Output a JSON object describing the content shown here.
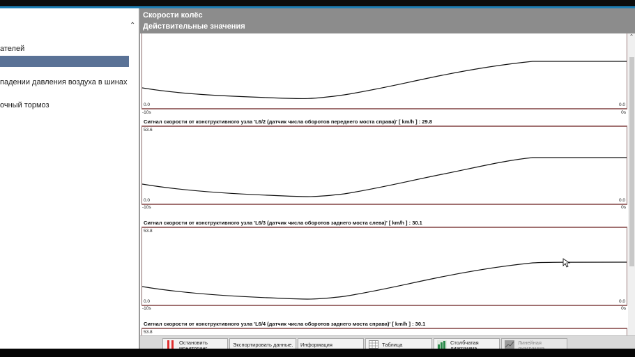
{
  "left_panel": {
    "items": [
      {
        "label": "ателей"
      },
      {
        "label": ""
      },
      {
        "label": "падении давления воздуха в шинах"
      },
      {
        "label": "очный тормоз"
      }
    ]
  },
  "header": {
    "title": "Скорости колёс",
    "subtitle": "Действительные значения"
  },
  "panels": [
    {
      "title": "",
      "y_max": "",
      "y_min_left": "0.0",
      "y_min_right": "0.0",
      "x_left": "-10s",
      "x_right": "0s"
    },
    {
      "title": "Сигнал скорости от конструктивного узла 'L6/2 (датчик числа оборотов переднего моста справа)' [ km/h ] : 29.8",
      "y_max": "53.6",
      "y_min_left": "0.0",
      "y_min_right": "0.0",
      "x_left": "-10s",
      "x_right": "0s"
    },
    {
      "title": "Сигнал скорости от конструктивного узла 'L6/3 (датчик числа оборотов заднего моста слева)' [ km/h ] : 30.1",
      "y_max": "53.8",
      "y_min_left": "0.0",
      "y_min_right": "0.0",
      "x_left": "-10s",
      "x_right": "0s"
    },
    {
      "title": "Сигнал скорости от конструктивного узла 'L6/4 (датчик числа оборотов заднего моста справа)' [ km/h ] : 30.1",
      "y_max": "53.8",
      "y_min_left": "",
      "y_min_right": "",
      "x_left": "",
      "x_right": ""
    }
  ],
  "toolbar": {
    "stop": "Остановить мониторинг",
    "export": "Экспортировать данные.",
    "info": "Информация",
    "table": "Таблица",
    "bar": "Столбчатая диаграмма",
    "line": "Линейная диаграмма"
  },
  "colors": {
    "header_bg": "#8c8c8c",
    "selection": "#5a7296",
    "accent": "#1e7fb5",
    "stop_icon": "#e03030"
  }
}
